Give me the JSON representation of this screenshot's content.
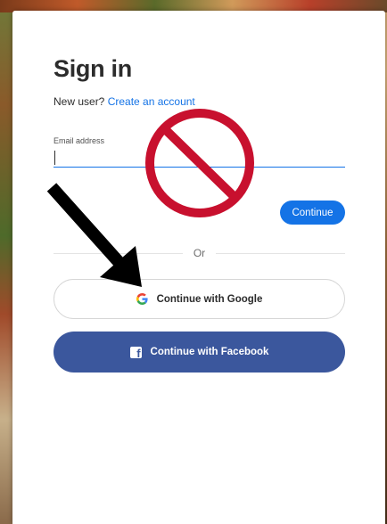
{
  "signin": {
    "title": "Sign in",
    "new_user_prompt": "New user?",
    "create_account_link": "Create an account",
    "email_label": "Email address",
    "email_value": "",
    "continue_label": "Continue",
    "divider_text": "Or",
    "google_label": "Continue with Google",
    "facebook_label": "Continue with Facebook"
  },
  "icons": {
    "google": "google-g-icon",
    "facebook": "facebook-f-icon",
    "prohibited": "no-symbol-annotation",
    "arrow": "arrow-annotation"
  },
  "colors": {
    "accent": "#1473e6",
    "facebook": "#3b579d",
    "prohibited": "#c8102e"
  }
}
